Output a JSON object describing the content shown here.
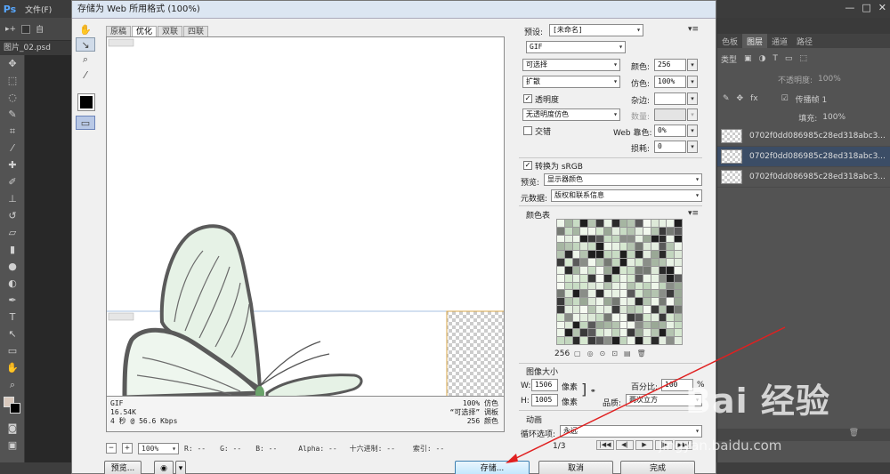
{
  "app": {
    "logo": "Ps",
    "menu": [
      "文件(F)"
    ],
    "document_tab": "图片_02.psd",
    "options_partial": "自"
  },
  "dialog": {
    "title": "存储为 Web 所用格式 (100%)",
    "view_tabs": [
      "原稿",
      "优化",
      "双联",
      "四联"
    ],
    "active_tab": "优化",
    "preview_info_left": [
      "GIF",
      "16.54K",
      "4 秒 @ 56.6 Kbps"
    ],
    "preview_info_right": [
      "100% 仿色",
      "“可选择” 调板",
      "256 颜色"
    ],
    "zoom": {
      "minus": "−",
      "plus": "+",
      "value": "100%",
      "r": "R: --",
      "g": "G: --",
      "b": "B: --",
      "alpha": "Alpha: --",
      "hex": "十六进制: --",
      "index": "索引: --"
    },
    "buttons": {
      "preview": "预览...",
      "save": "存储...",
      "cancel": "取消",
      "done": "完成"
    }
  },
  "settings": {
    "preset_label": "预设:",
    "preset_value": "[未命名]",
    "format": "GIF",
    "reduction": "可选择",
    "colors_label": "颜色:",
    "colors_value": "256",
    "dither_algo": "扩散",
    "dither_label": "仿色:",
    "dither_value": "100%",
    "transparency_label": "透明度",
    "transparency_checked": "✓",
    "matte_label": "杂边:",
    "matte_value": "",
    "trans_dither": "无透明度仿色",
    "amount_label": "数量:",
    "amount_value": "",
    "interlaced_label": "交错",
    "websnap_label": "Web 靠色:",
    "websnap_value": "0%",
    "lossy_label": "损耗:",
    "lossy_value": "0",
    "srgb_label": "转换为 sRGB",
    "srgb_checked": "✓",
    "preview_label": "预览:",
    "preview_value": "显示器颜色",
    "metadata_label": "元数据:",
    "metadata_value": "版权和联系信息",
    "color_table_label": "颜色表",
    "color_table_count": "256",
    "image_size_label": "图像大小",
    "w_label": "W:",
    "w_value": "1506",
    "w_unit": "像素",
    "h_label": "H:",
    "h_value": "1005",
    "h_unit": "像素",
    "percent_label": "百分比:",
    "percent_value": "100",
    "percent_unit": "%",
    "quality_label": "品质:",
    "quality_value": "两次立方",
    "animation_label": "动画",
    "loop_label": "循环选项:",
    "loop_value": "永远",
    "frame_counter": "1/3"
  },
  "layers_panel": {
    "tabs": [
      "色板",
      "图层",
      "通道",
      "路径"
    ],
    "active_tab": "图层",
    "filter": "类型",
    "opacity_label": "不透明度:",
    "opacity_value": "100%",
    "propagate_label": "传播帧 1",
    "fill_label": "填充:",
    "fill_value": "100%",
    "layers": [
      "0702f0dd086985c28ed318abc3...",
      "0702f0dd086985c28ed318abc3...",
      "0702f0dd086985c28ed318abc3..."
    ],
    "selected_index": 1
  },
  "watermark": {
    "brand": "Bai 经验",
    "url": "jingyan.baidu.com"
  },
  "colors": {
    "accent": "#3c7fb1",
    "selection": "#3b4d66",
    "arrow": "#e02020"
  }
}
